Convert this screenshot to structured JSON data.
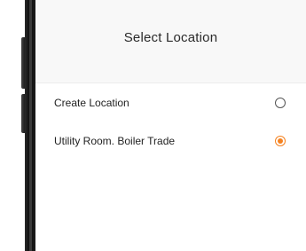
{
  "header": {
    "title": "Select Location"
  },
  "locations": [
    {
      "label": "Create Location",
      "selected": false
    },
    {
      "label": "Utility Room. Boiler Trade",
      "selected": true
    }
  ],
  "colors": {
    "accent": "#f58220",
    "header_bg": "#f8f8f8",
    "radio_border": "#555555"
  }
}
